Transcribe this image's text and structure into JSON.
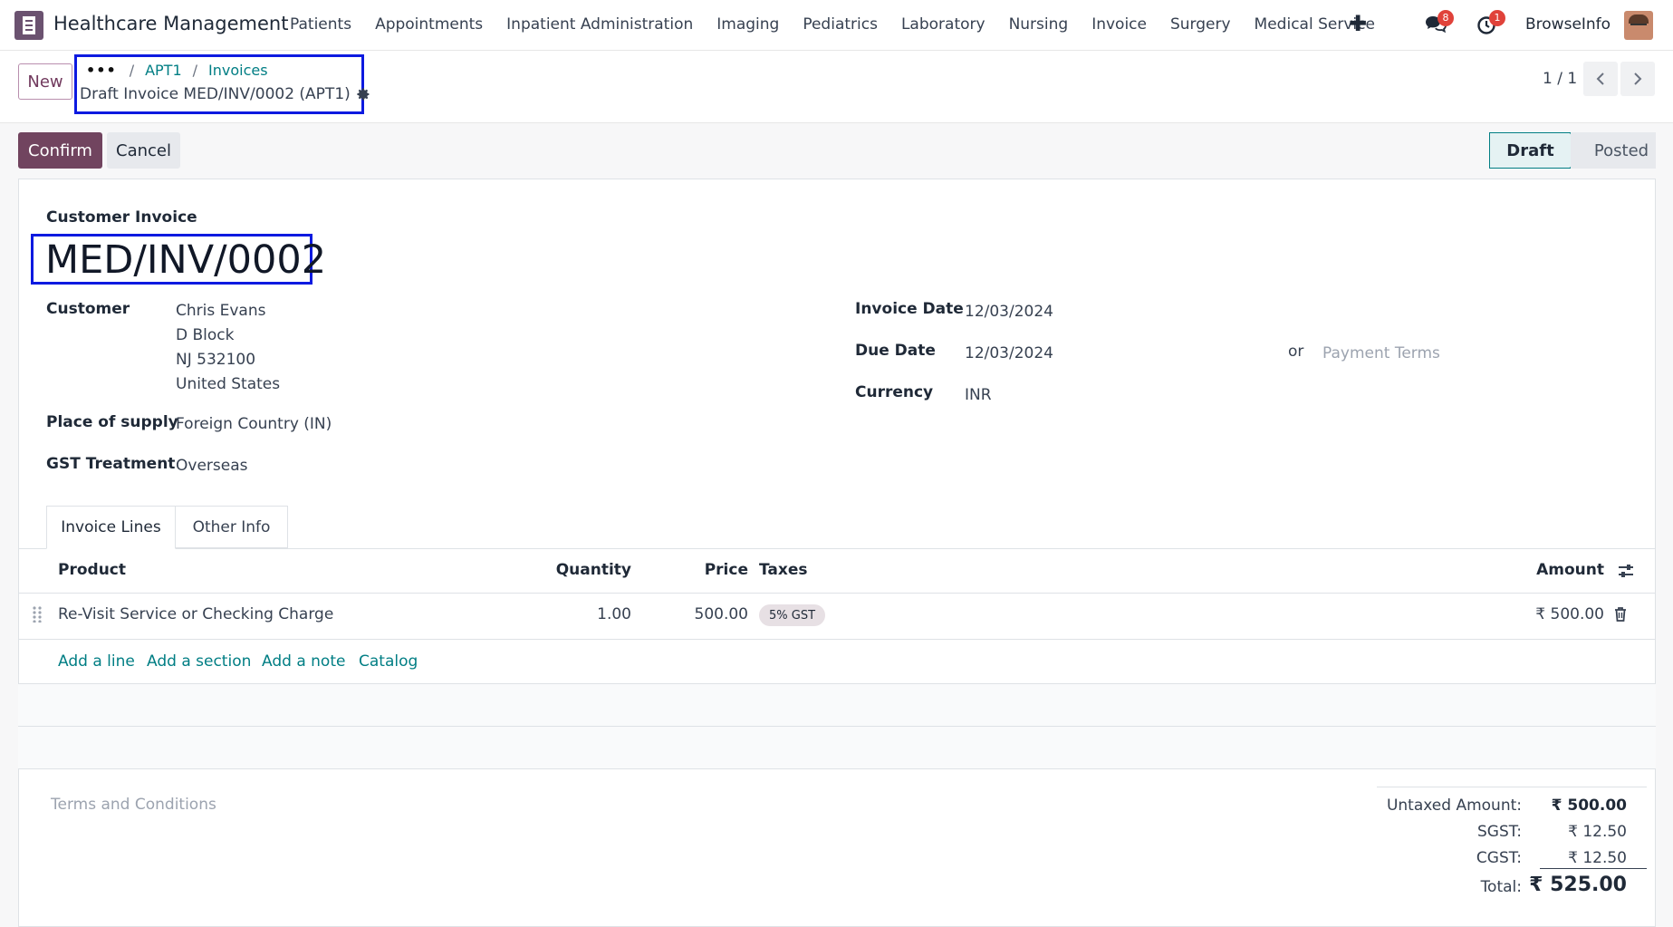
{
  "navbar": {
    "app_title": "Healthcare Management",
    "menu": [
      "Patients",
      "Appointments",
      "Inpatient Administration",
      "Imaging",
      "Pediatrics",
      "Laboratory",
      "Nursing",
      "Invoice",
      "Surgery",
      "Medical Service"
    ],
    "plus": "✚",
    "messages_count": "8",
    "activities_count": "1",
    "user": "BrowseInfo"
  },
  "control": {
    "new_label": "New",
    "breadcrumb_dots": "•••",
    "breadcrumb": [
      "APT1",
      "Invoices"
    ],
    "record_title": "Draft Invoice MED/INV/0002 (APT1)",
    "pager": "1 / 1"
  },
  "actions": {
    "confirm": "Confirm",
    "cancel": "Cancel",
    "status_draft": "Draft",
    "status_posted": "Posted"
  },
  "invoice": {
    "type_label": "Customer Invoice",
    "number": "MED/INV/0002",
    "customer_label": "Customer",
    "customer_lines": [
      "Chris Evans",
      "D Block",
      "NJ 532100",
      "United States"
    ],
    "supply_label": "Place of supply",
    "supply_value": "Foreign Country (IN)",
    "gst_label": "GST Treatment",
    "gst_value": "Overseas",
    "invoice_date_label": "Invoice Date",
    "invoice_date": "12/03/2024",
    "due_date_label": "Due Date",
    "due_date": "12/03/2024",
    "or_label": "or",
    "payment_terms_placeholder": "Payment Terms",
    "currency_label": "Currency",
    "currency": "INR"
  },
  "tabs": [
    "Invoice Lines",
    "Other Info"
  ],
  "lines": {
    "headers": {
      "product": "Product",
      "quantity": "Quantity",
      "price": "Price",
      "taxes": "Taxes",
      "amount": "Amount"
    },
    "rows": [
      {
        "product": "Re-Visit Service or Checking Charge",
        "quantity": "1.00",
        "price": "500.00",
        "tax": "5% GST",
        "amount": "₹ 500.00"
      }
    ],
    "add_links": [
      "Add a line",
      "Add a section",
      "Add a note",
      "Catalog"
    ]
  },
  "footer": {
    "terms_placeholder": "Terms and Conditions",
    "totals": [
      {
        "label": "Untaxed Amount:",
        "value": "₹ 500.00"
      },
      {
        "label": "SGST:",
        "value": "₹ 12.50"
      },
      {
        "label": "CGST:",
        "value": "₹ 12.50"
      },
      {
        "label": "Total:",
        "value": "₹ 525.00"
      }
    ]
  },
  "colors": {
    "primary": "#71445f",
    "link": "#017e84",
    "highlight_box": "#0d1ae0",
    "badge": "#e0423a"
  }
}
